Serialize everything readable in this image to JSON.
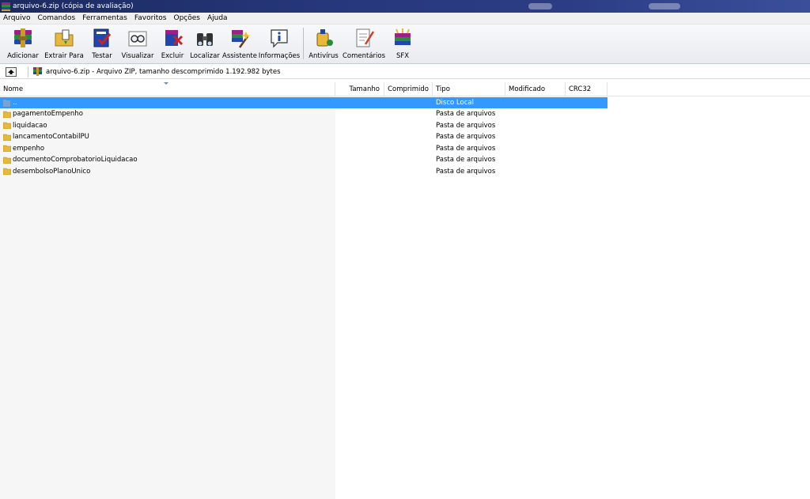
{
  "window": {
    "title": "arquivo-6.zip (cópia de avaliação)"
  },
  "menu": [
    "Arquivo",
    "Comandos",
    "Ferramentas",
    "Favoritos",
    "Opções",
    "Ajuda"
  ],
  "toolbar": {
    "buttons": [
      {
        "label": "Adicionar",
        "icon": "add-archive-icon"
      },
      {
        "label": "Extrair Para",
        "icon": "extract-folder-icon"
      },
      {
        "label": "Testar",
        "icon": "test-archive-icon"
      },
      {
        "label": "Visualizar",
        "icon": "view-glasses-icon"
      },
      {
        "label": "Excluir",
        "icon": "delete-icon"
      },
      {
        "label": "Localizar",
        "icon": "binoculars-icon"
      },
      {
        "label": "Assistente",
        "icon": "wizard-icon"
      },
      {
        "label": "Informações",
        "icon": "info-icon"
      },
      {
        "label": "Antivírus",
        "icon": "antivirus-icon"
      },
      {
        "label": "Comentários",
        "icon": "comment-icon"
      },
      {
        "label": "SFX",
        "icon": "sfx-icon"
      }
    ]
  },
  "address": {
    "text": "arquivo-6.zip - Arquivo ZIP, tamanho descomprimido 1.192.982 bytes"
  },
  "columns": [
    "Nome",
    "Tamanho",
    "Comprimido",
    "Tipo",
    "Modificado",
    "CRC32"
  ],
  "rows": [
    {
      "name": "..",
      "type": "Disco Local",
      "selected": true
    },
    {
      "name": "pagamentoEmpenho",
      "type": "Pasta de arquivos"
    },
    {
      "name": "liquidacao",
      "type": "Pasta de arquivos"
    },
    {
      "name": "lancamentoContabilPU",
      "type": "Pasta de arquivos"
    },
    {
      "name": "empenho",
      "type": "Pasta de arquivos"
    },
    {
      "name": "documentoComprobatorioLiquidacao",
      "type": "Pasta de arquivos"
    },
    {
      "name": "desembolsoPlanoUnico",
      "type": "Pasta de arquivos"
    }
  ],
  "colors": {
    "selection": "#3399ff",
    "titlebar": "#26377a",
    "folder": "#e8b83a"
  }
}
